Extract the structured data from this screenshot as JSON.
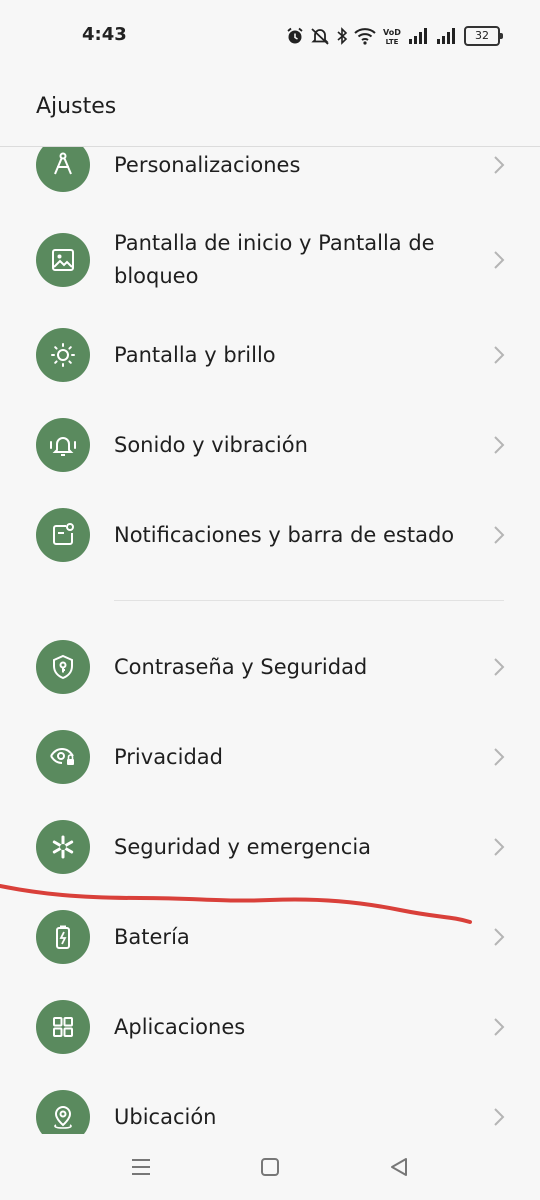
{
  "status_bar": {
    "time": "4:43",
    "battery": "32",
    "network_label": "VoLTE"
  },
  "header": {
    "title": "Ajustes"
  },
  "settings": {
    "group1": [
      {
        "label": "Personalizaciones",
        "icon": "compass-icon"
      },
      {
        "label": "Pantalla de inicio y Pantalla de bloqueo",
        "icon": "image-icon"
      },
      {
        "label": "Pantalla y brillo",
        "icon": "sun-icon"
      },
      {
        "label": "Sonido y vibración",
        "icon": "bell-icon"
      },
      {
        "label": "Notificaciones y barra de estado",
        "icon": "notification-icon"
      }
    ],
    "group2": [
      {
        "label": "Contraseña y Seguridad",
        "icon": "shield-key-icon"
      },
      {
        "label": "Privacidad",
        "icon": "eye-lock-icon"
      },
      {
        "label": "Seguridad y emergencia",
        "icon": "asterisk-icon"
      },
      {
        "label": "Batería",
        "icon": "battery-icon"
      },
      {
        "label": "Aplicaciones",
        "icon": "grid-icon"
      },
      {
        "label": "Ubicación",
        "icon": "location-pin-icon"
      }
    ]
  },
  "colors": {
    "icon_bg": "#5a8a5e",
    "annotation_stroke": "#d9403a"
  }
}
